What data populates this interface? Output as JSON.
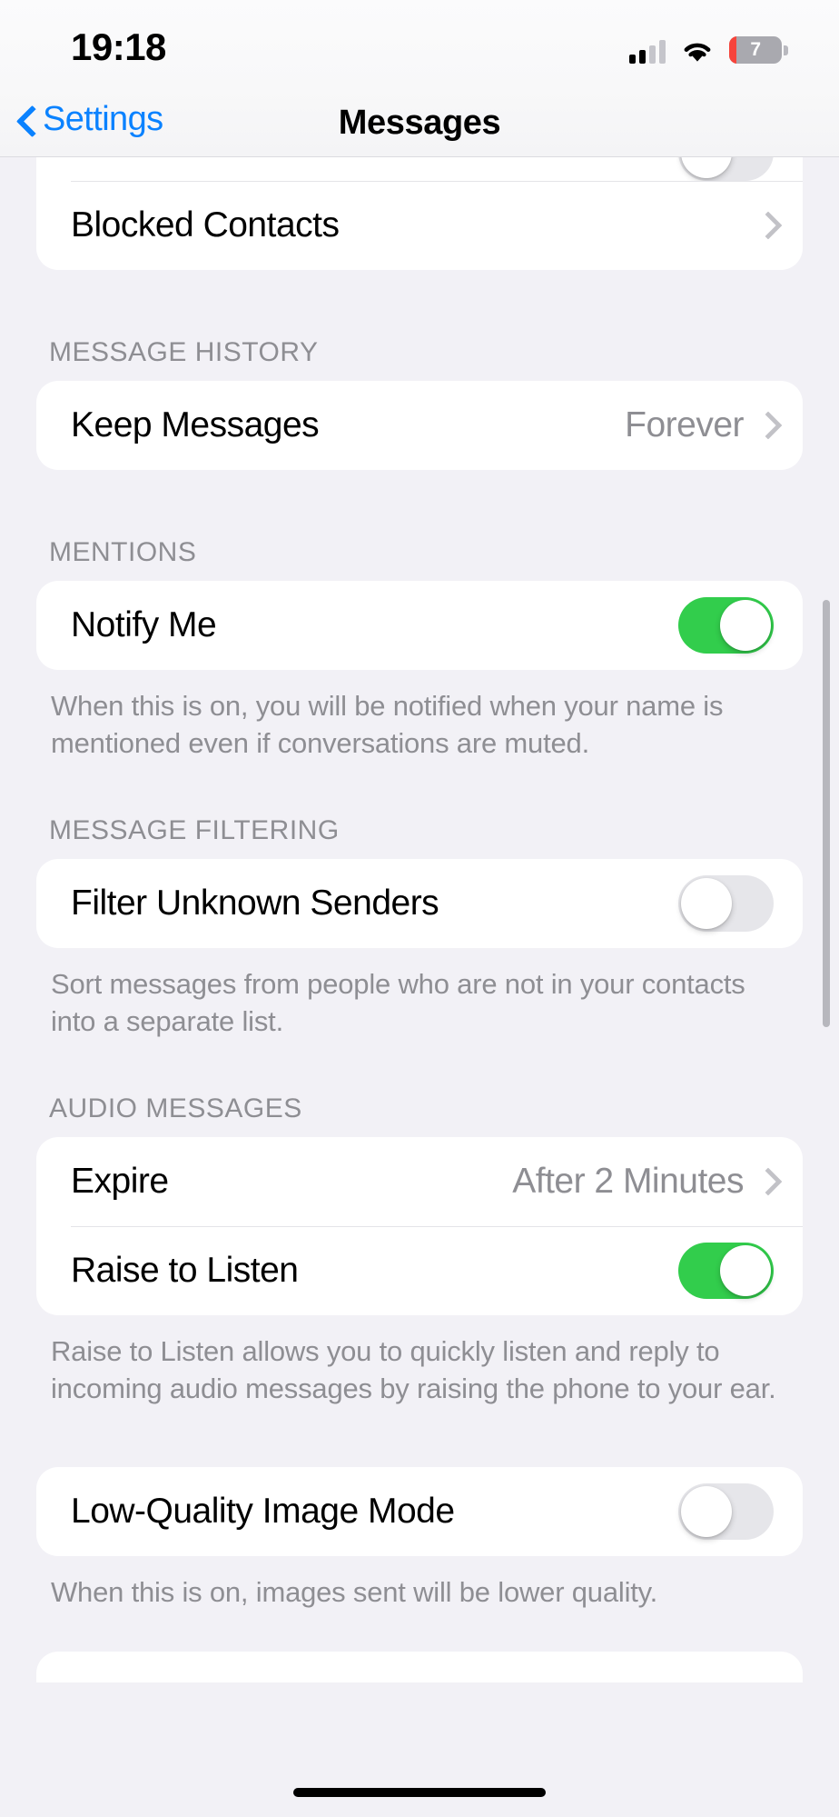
{
  "status_bar": {
    "time": "19:18",
    "cellular_icon": "cellular-signal-icon",
    "cellular_bars_filled": 2,
    "cellular_bars_total": 4,
    "wifi_icon": "wifi-icon",
    "battery_icon": "battery-icon",
    "battery_percent": "7",
    "battery_low_color": "#f6443b"
  },
  "nav": {
    "back_label": "Settings",
    "back_icon": "chevron-left-icon",
    "title": "Messages",
    "accent_color": "#0a82ff"
  },
  "sections": {
    "blocked": {
      "row_label": "Blocked Contacts",
      "disclosure_icon": "chevron-right-icon"
    },
    "message_history": {
      "header": "MESSAGE HISTORY",
      "keep_messages_label": "Keep Messages",
      "keep_messages_value": "Forever",
      "disclosure_icon": "chevron-right-icon"
    },
    "mentions": {
      "header": "MENTIONS",
      "notify_me_label": "Notify Me",
      "notify_me_state": "on",
      "footer": "When this is on, you will be notified when your name is mentioned even if conversations are muted."
    },
    "message_filtering": {
      "header": "MESSAGE FILTERING",
      "filter_label": "Filter Unknown Senders",
      "filter_state": "off",
      "footer": "Sort messages from people who are not in your contacts into a separate list."
    },
    "audio_messages": {
      "header": "AUDIO MESSAGES",
      "expire_label": "Expire",
      "expire_value": "After 2 Minutes",
      "disclosure_icon": "chevron-right-icon",
      "raise_label": "Raise to Listen",
      "raise_state": "on",
      "footer": "Raise to Listen allows you to quickly listen and reply to incoming audio messages by raising the phone to your ear."
    },
    "low_quality": {
      "row_label": "Low-Quality Image Mode",
      "state": "off",
      "footer": "When this is on, images sent will be lower quality."
    }
  },
  "colors": {
    "toggle_on": "#32cd4c",
    "toggle_off": "#e6e6ea",
    "page_background": "#f2f1f6",
    "card_background": "#ffffff",
    "secondary_text": "#8e8e93"
  }
}
